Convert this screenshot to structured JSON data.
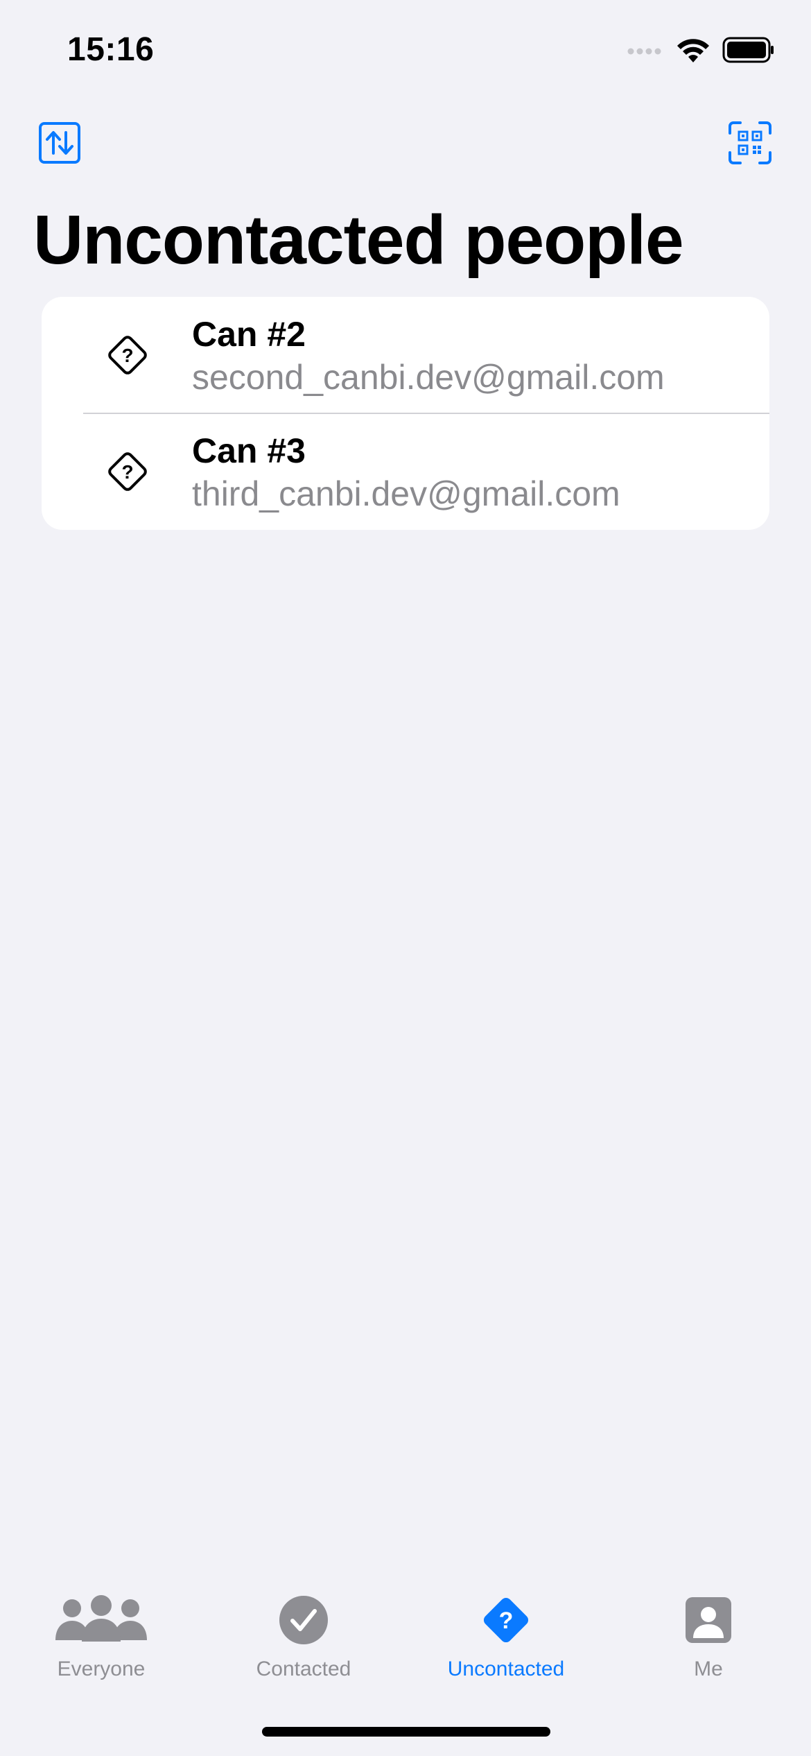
{
  "status_bar": {
    "time": "15:16"
  },
  "nav": {
    "left_icon": "arrow-up-down-icon",
    "right_icon": "qr-code-scan-icon",
    "accent": "#0a7aff"
  },
  "page": {
    "title": "Uncontacted people"
  },
  "people": [
    {
      "name": "Can #2",
      "email": "second_canbi.dev@gmail.com",
      "icon": "question-diamond-icon"
    },
    {
      "name": "Can #3",
      "email": "third_canbi.dev@gmail.com",
      "icon": "question-diamond-icon"
    }
  ],
  "tab_bar": {
    "tabs": [
      {
        "label": "Everyone",
        "icon": "people-group-icon",
        "selected": false
      },
      {
        "label": "Contacted",
        "icon": "checkmark-circle-icon",
        "selected": false
      },
      {
        "label": "Uncontacted",
        "icon": "question-diamond-fill-icon",
        "selected": true
      },
      {
        "label": "Me",
        "icon": "person-square-icon",
        "selected": false
      }
    ],
    "active_color": "#0a7aff",
    "inactive_color": "#8e8e93"
  }
}
